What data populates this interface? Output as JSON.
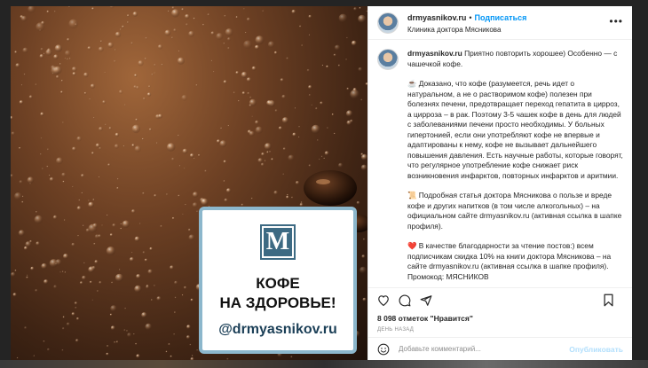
{
  "post": {
    "username": "drmyasnikov.ru",
    "follow_label": "Подписаться",
    "location": "Клиника доктора Мясникова",
    "caption_intro": "Приятно повторить хорошее) Особенно — с чашечкой кофе.",
    "paragraphs": [
      "☕ Доказано, что кофе (разумеется, речь идет о натуральном, а не о растворимом кофе) полезен при болезнях печени, предотвращает переход гепатита в цирроз, а цирроза – в рак. Поэтому 3-5 чашек кофе в день для людей с заболеваниями печени просто необходимы. У больных гипертонией, если они употребляют кофе не впервые и адаптированы к нему, кофе не вызывает дальнейшего повышения давления. Есть научные работы, которые говорят, что регулярное употребление кофе снижает риск возникновения инфарктов, повторных инфарктов и аритмии.",
      "📜 Подробная статья доктора Мясникова о пользе и вреде кофе и других напитков (в том числе алкогольных) – на официальном сайте drmyasnikov.ru (активная ссылка в шапке профиля).",
      "❤️ В качестве благодарности за чтение постов:) всем подписчикам скидка 10% на книги доктора Мясникова – на сайте drmyasnikov.ru (активная ссылка в шапке профиля). Промокод: МЯСНИКОВ"
    ],
    "likes": "8 098 отметок \"Нравится\"",
    "date": "ДЕНЬ НАЗАД",
    "comment_placeholder": "Добавьте комментарий...",
    "publish_label": "Опубликовать"
  },
  "image": {
    "logo_letter": "M",
    "title_line1": "КОФЕ",
    "title_line2": "НА ЗДОРОВЬЕ!",
    "handle": "@drmyasnikov.ru"
  },
  "icons": {
    "like": "heart-icon",
    "comment": "comment-icon",
    "share": "paper-plane-icon",
    "save": "bookmark-icon",
    "emoji": "smiley-icon",
    "more": "more-dots-icon"
  },
  "colors": {
    "link_blue": "#0095f6",
    "publish_disabled": "#b2dffc",
    "promo_border": "#8cb7cc",
    "logo_bg": "#3d6a83"
  }
}
